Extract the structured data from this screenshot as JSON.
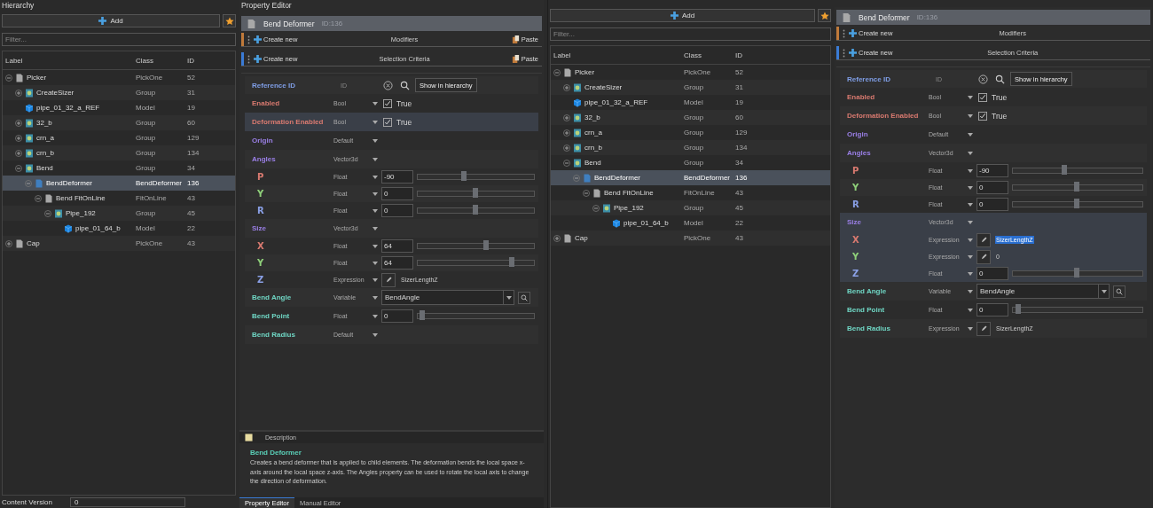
{
  "views": [
    {
      "hierarchy": {
        "title": "Hierarchy",
        "add_label": "Add",
        "filter_placeholder": "Filter...",
        "columns": [
          "Label",
          "Class",
          "ID"
        ],
        "rows": [
          {
            "label": "Picker",
            "kind": "item",
            "class": "PickOne",
            "id": "52",
            "expanded": true,
            "selected": false,
            "children": [
              {
                "label": "CreateSizer",
                "kind": "group",
                "class": "Group",
                "id": "31",
                "expanded": false,
                "selected": false
              },
              {
                "label": "pipe_01_32_a_REF",
                "kind": "model",
                "class": "Model",
                "id": "19",
                "selected": false
              },
              {
                "label": "32_b",
                "kind": "group",
                "class": "Group",
                "id": "60",
                "expanded": false,
                "selected": false
              },
              {
                "label": "crn_a",
                "kind": "group",
                "class": "Group",
                "id": "129",
                "expanded": false,
                "selected": false
              },
              {
                "label": "crn_b",
                "kind": "group",
                "class": "Group",
                "id": "134",
                "expanded": false,
                "selected": false
              },
              {
                "label": "Bend",
                "kind": "group",
                "class": "Group",
                "id": "34",
                "expanded": true,
                "selected": false,
                "children": [
                  {
                    "label": "BendDeformer",
                    "kind": "deformer",
                    "class": "BendDeformer",
                    "id": "136",
                    "expanded": true,
                    "selected": true,
                    "children": [
                      {
                        "label": "Bend FitOnLine",
                        "kind": "item",
                        "class": "FitOnLine",
                        "id": "43",
                        "expanded": true,
                        "selected": false,
                        "children": [
                          {
                            "label": "Pipe_192",
                            "kind": "group",
                            "class": "Group",
                            "id": "45",
                            "expanded": true,
                            "selected": false,
                            "children": [
                              {
                                "label": "pipe_01_64_b",
                                "kind": "model",
                                "class": "Model",
                                "id": "22",
                                "selected": false
                              }
                            ]
                          }
                        ]
                      }
                    ]
                  }
                ]
              }
            ]
          },
          {
            "label": "Cap",
            "kind": "item",
            "class": "PickOne",
            "id": "43",
            "expanded": false,
            "selected": false
          }
        ],
        "content_version": {
          "label": "Content Version",
          "value": "0"
        }
      },
      "property_editor": {
        "title": "Property Editor",
        "header": {
          "name": "Bend Deformer",
          "id_text": "ID:136"
        },
        "sections": [
          {
            "create_label": "Create new",
            "title": "Modifiers",
            "paste": "Paste",
            "color": "#c07a3a"
          },
          {
            "create_label": "Create new",
            "title": "Selection Criteria",
            "paste": "Paste",
            "color": "#3a7bd5"
          }
        ],
        "reference": {
          "label": "Reference ID",
          "placeholder": "ID",
          "button": "Show in hierarchy"
        },
        "properties": [
          {
            "kind": "bool",
            "label": "Enabled",
            "color": "#d97a70",
            "type": "Bool",
            "checked": true,
            "value": "True",
            "selected": false
          },
          {
            "kind": "bool",
            "label": "Deformation Enabled",
            "color": "#d97a70",
            "type": "Bool",
            "checked": true,
            "value": "True",
            "selected": true
          },
          {
            "kind": "default",
            "label": "Origin",
            "color": "#9a7fe6",
            "type": "Default",
            "selected": false
          },
          {
            "kind": "vector",
            "label": "Angles",
            "color": "#9a7fe6",
            "type": "Vector3d",
            "selected": false,
            "children": [
              {
                "kind": "float",
                "label": "P",
                "color": "#d97a70",
                "type": "Float",
                "value": "-90",
                "level": 0.4
              },
              {
                "kind": "float",
                "label": "Y",
                "color": "#8fd07a",
                "type": "Float",
                "value": "0",
                "level": 0.5
              },
              {
                "kind": "float",
                "label": "R",
                "color": "#8aa0e6",
                "type": "Float",
                "value": "0",
                "level": 0.5
              }
            ]
          },
          {
            "kind": "vector",
            "label": "Size",
            "color": "#9a7fe6",
            "type": "Vector3d",
            "selected": false,
            "children": [
              {
                "kind": "float",
                "label": "X",
                "color": "#d97a70",
                "type": "Float",
                "value": "64",
                "level": 0.6
              },
              {
                "kind": "float",
                "label": "Y",
                "color": "#8fd07a",
                "type": "Float",
                "value": "64",
                "level": 0.84
              },
              {
                "kind": "expression",
                "label": "Z",
                "color": "#8aa0e6",
                "type": "Expression",
                "value": "SizerLengthZ",
                "text_selected": false
              }
            ]
          },
          {
            "kind": "variable",
            "label": "Bend Angle",
            "color": "#6fd6c4",
            "type": "Variable",
            "value": "BendAngle",
            "selected": false
          },
          {
            "kind": "float",
            "label": "Bend Point",
            "color": "#6fd6c4",
            "type": "Float",
            "value": "0",
            "level": 0.02,
            "selected": false
          },
          {
            "kind": "default",
            "label": "Bend Radius",
            "color": "#6fd6c4",
            "type": "Default",
            "selected": false
          }
        ],
        "description": {
          "heading": "Description",
          "title": "Bend Deformer",
          "text": "Creates a bend deformer that is applied to child elements. The deformation bends the local space x-axis around the local space z-axis. The Angles property can be used to rotate the local axis to change the direction of deformation."
        },
        "tabs": [
          {
            "label": "Property Editor",
            "selected": true
          },
          {
            "label": "Manual Editor",
            "selected": false
          }
        ]
      }
    },
    {
      "hierarchy": {
        "add_label": "Add",
        "filter_placeholder": "Filter...",
        "columns": [
          "Label",
          "Class",
          "ID"
        ],
        "rows": [
          {
            "label": "Picker",
            "kind": "item",
            "class": "PickOne",
            "id": "52",
            "expanded": true,
            "selected": false,
            "children": [
              {
                "label": "CreateSizer",
                "kind": "group",
                "class": "Group",
                "id": "31",
                "expanded": false,
                "selected": false
              },
              {
                "label": "pipe_01_32_a_REF",
                "kind": "model",
                "class": "Model",
                "id": "19",
                "selected": false
              },
              {
                "label": "32_b",
                "kind": "group",
                "class": "Group",
                "id": "60",
                "expanded": false,
                "selected": false
              },
              {
                "label": "crn_a",
                "kind": "group",
                "class": "Group",
                "id": "129",
                "expanded": false,
                "selected": false
              },
              {
                "label": "crn_b",
                "kind": "group",
                "class": "Group",
                "id": "134",
                "expanded": false,
                "selected": false
              },
              {
                "label": "Bend",
                "kind": "group",
                "class": "Group",
                "id": "34",
                "expanded": true,
                "selected": false,
                "children": [
                  {
                    "label": "BendDeformer",
                    "kind": "deformer",
                    "class": "BendDeformer",
                    "id": "136",
                    "expanded": true,
                    "selected": true,
                    "children": [
                      {
                        "label": "Bend FitOnLine",
                        "kind": "item",
                        "class": "FitOnLine",
                        "id": "43",
                        "expanded": true,
                        "selected": false,
                        "children": [
                          {
                            "label": "Pipe_192",
                            "kind": "group",
                            "class": "Group",
                            "id": "45",
                            "expanded": true,
                            "selected": false,
                            "children": [
                              {
                                "label": "pipe_01_64_b",
                                "kind": "model",
                                "class": "Model",
                                "id": "22",
                                "selected": false
                              }
                            ]
                          }
                        ]
                      }
                    ]
                  }
                ]
              }
            ]
          },
          {
            "label": "Cap",
            "kind": "item",
            "class": "PickOne",
            "id": "43",
            "expanded": false,
            "selected": false
          }
        ]
      },
      "property_editor": {
        "header": {
          "name": "Bend Deformer",
          "id_text": "ID:136"
        },
        "sections": [
          {
            "create_label": "Create new",
            "title": "Modifiers",
            "color": "#c07a3a"
          },
          {
            "create_label": "Create new",
            "title": "Selection Criteria",
            "color": "#3a7bd5"
          }
        ],
        "reference": {
          "label": "Reference ID",
          "placeholder": "ID",
          "button": "Show in hierarchy"
        },
        "properties": [
          {
            "kind": "bool",
            "label": "Enabled",
            "color": "#d97a70",
            "type": "Bool",
            "checked": true,
            "value": "True",
            "selected": false
          },
          {
            "kind": "bool",
            "label": "Deformation Enabled",
            "color": "#d97a70",
            "type": "Bool",
            "checked": true,
            "value": "True",
            "selected": false
          },
          {
            "kind": "default",
            "label": "Origin",
            "color": "#9a7fe6",
            "type": "Default",
            "selected": false
          },
          {
            "kind": "vector",
            "label": "Angles",
            "color": "#9a7fe6",
            "type": "Vector3d",
            "selected": false,
            "children": [
              {
                "kind": "float",
                "label": "P",
                "color": "#d97a70",
                "type": "Float",
                "value": "-90",
                "level": 0.4
              },
              {
                "kind": "float",
                "label": "Y",
                "color": "#8fd07a",
                "type": "Float",
                "value": "0",
                "level": 0.5
              },
              {
                "kind": "float",
                "label": "R",
                "color": "#8aa0e6",
                "type": "Float",
                "value": "0",
                "level": 0.5
              }
            ]
          },
          {
            "kind": "vector",
            "label": "Size",
            "color": "#9a7fe6",
            "type": "Vector3d",
            "selected": true,
            "children": [
              {
                "kind": "expression",
                "label": "X",
                "color": "#d97a70",
                "type": "Expression",
                "value": "SizerLengthZ",
                "text_selected": true
              },
              {
                "kind": "expression",
                "label": "Y",
                "color": "#8fd07a",
                "type": "Expression",
                "value": "0",
                "text_selected": false
              },
              {
                "kind": "float",
                "label": "Z",
                "color": "#8aa0e6",
                "type": "Float",
                "value": "0",
                "level": 0.5
              }
            ]
          },
          {
            "kind": "variable",
            "label": "Bend Angle",
            "color": "#6fd6c4",
            "type": "Variable",
            "value": "BendAngle",
            "selected": false
          },
          {
            "kind": "float",
            "label": "Bend Point",
            "color": "#6fd6c4",
            "type": "Float",
            "value": "0",
            "level": 0.02,
            "selected": false
          },
          {
            "kind": "expression",
            "label": "Bend Radius",
            "color": "#6fd6c4",
            "type": "Expression",
            "value": "SizerLengthZ",
            "text_selected": false,
            "selected": false
          }
        ]
      }
    }
  ]
}
